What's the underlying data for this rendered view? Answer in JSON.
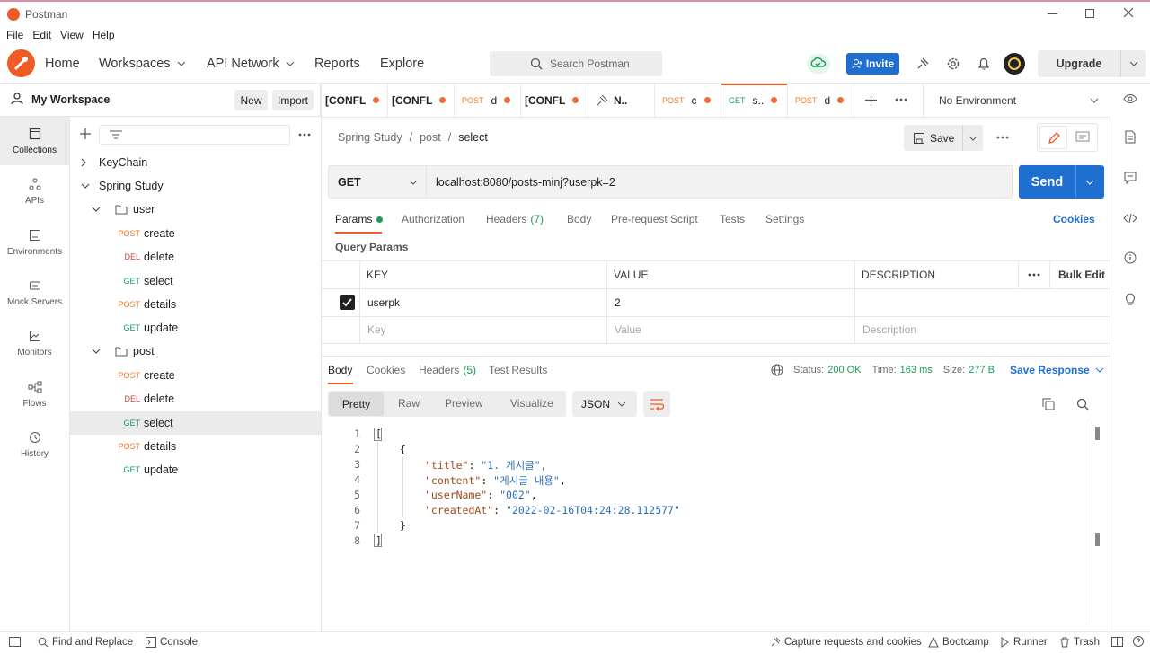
{
  "window": {
    "title": "Postman"
  },
  "menu": [
    "File",
    "Edit",
    "View",
    "Help"
  ],
  "nav": {
    "home": "Home",
    "workspaces": "Workspaces",
    "api_network": "API Network",
    "reports": "Reports",
    "explore": "Explore",
    "search_placeholder": "Search Postman",
    "invite": "Invite",
    "upgrade": "Upgrade"
  },
  "workspace": {
    "name": "My Workspace",
    "new": "New",
    "import": "Import"
  },
  "sidebar": [
    "Collections",
    "APIs",
    "Environments",
    "Mock Servers",
    "Monitors",
    "Flows",
    "History"
  ],
  "tabs": [
    {
      "verb": "",
      "label": "[CONFL"
    },
    {
      "verb": "",
      "label": "[CONFL"
    },
    {
      "verb": "POST",
      "label": "d"
    },
    {
      "verb": "",
      "label": "[CONFL"
    },
    {
      "verb": "",
      "label": "N.."
    },
    {
      "verb": "POST",
      "label": "c"
    },
    {
      "verb": "GET",
      "label": "s.."
    },
    {
      "verb": "POST",
      "label": "d"
    }
  ],
  "environment": "No Environment",
  "tree": {
    "keychain": "KeyChain",
    "collection": "Spring Study",
    "user_folder": "user",
    "user_items": [
      {
        "verb": "POST",
        "name": "create"
      },
      {
        "verb": "DEL",
        "name": "delete"
      },
      {
        "verb": "GET",
        "name": "select"
      },
      {
        "verb": "POST",
        "name": "details"
      },
      {
        "verb": "GET",
        "name": "update"
      }
    ],
    "post_folder": "post",
    "post_items": [
      {
        "verb": "POST",
        "name": "create"
      },
      {
        "verb": "DEL",
        "name": "delete"
      },
      {
        "verb": "GET",
        "name": "select"
      },
      {
        "verb": "POST",
        "name": "details"
      },
      {
        "verb": "GET",
        "name": "update"
      }
    ]
  },
  "breadcrumb": {
    "a": "Spring Study",
    "b": "post",
    "c": "select",
    "sep": "/"
  },
  "save": "Save",
  "request": {
    "method": "GET",
    "url": "localhost:8080/posts-minj?userpk=2",
    "send": "Send"
  },
  "req_tabs": {
    "params": "Params",
    "auth": "Authorization",
    "headers": "Headers",
    "headers_count": "(7)",
    "body": "Body",
    "prereq": "Pre-request Script",
    "tests": "Tests",
    "settings": "Settings",
    "cookies": "Cookies"
  },
  "query": {
    "title": "Query Params",
    "col_key": "KEY",
    "col_value": "VALUE",
    "col_desc": "DESCRIPTION",
    "bulk": "Bulk Edit",
    "row_key": "userpk",
    "row_value": "2",
    "ph_key": "Key",
    "ph_value": "Value",
    "ph_desc": "Description"
  },
  "resp": {
    "body": "Body",
    "cookies": "Cookies",
    "headers": "Headers",
    "headers_count": "(5)",
    "tests": "Test Results",
    "status_l": "Status:",
    "status": "200 OK",
    "time_l": "Time:",
    "time": "163 ms",
    "size_l": "Size:",
    "size": "277 B",
    "save_response": "Save Response",
    "pretty": "Pretty",
    "raw": "Raw",
    "preview": "Preview",
    "visualize": "Visualize",
    "format": "JSON"
  },
  "code": {
    "l1": "[",
    "l2": "{",
    "k_title": "\"title\"",
    "v_title": "\"1. 게시글\"",
    "k_content": "\"content\"",
    "v_content": "\"게시글 내용\"",
    "k_user": "\"userName\"",
    "v_user": "\"002\"",
    "k_created": "\"createdAt\"",
    "v_created": "\"2022-02-16T04:24:28.112577\"",
    "l7": "}",
    "l8": "]"
  },
  "status_bar": {
    "find": "Find and Replace",
    "console": "Console",
    "capture": "Capture requests and cookies",
    "bootcamp": "Bootcamp",
    "runner": "Runner",
    "trash": "Trash"
  }
}
